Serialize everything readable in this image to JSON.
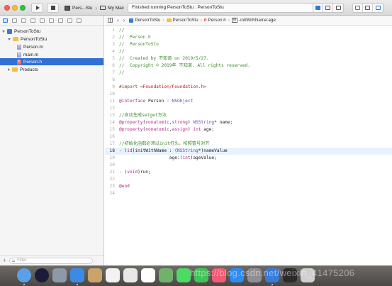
{
  "toolbar": {
    "scheme_target": "Pers...Stu",
    "scheme_device": "My Mac",
    "activity_status": "Finished running PersonToStu : PersonToStu"
  },
  "navigator": {
    "items": [
      {
        "label": "PersonToStu",
        "kind": "project"
      },
      {
        "label": "PersonToStu",
        "kind": "folder"
      },
      {
        "label": "Person.m",
        "kind": "m"
      },
      {
        "label": "main.m",
        "kind": "m"
      },
      {
        "label": "Person.h",
        "kind": "h",
        "selected": true
      },
      {
        "label": "Products",
        "kind": "folder"
      }
    ],
    "filter_placeholder": "Filter"
  },
  "jumpbar": {
    "crumbs": [
      "PersonToStu",
      "PersonToStu",
      "Person.h",
      "-initWithName:age:"
    ]
  },
  "editor": {
    "current_line": 18,
    "lines": [
      {
        "n": "1",
        "t": "//"
      },
      {
        "n": "2",
        "t": "//  Person.h"
      },
      {
        "n": "3",
        "t": "//  PersonToStu"
      },
      {
        "n": "4",
        "t": "//"
      },
      {
        "n": "5",
        "t": "//  Created by 不知道 on 2019/5/27."
      },
      {
        "n": "6",
        "t": "//  Copyright © 2019年 不知道. All rights reserved."
      },
      {
        "n": "7",
        "t": "//"
      },
      {
        "n": "8",
        "t": ""
      },
      {
        "n": "9",
        "t": "#import <Foundation/Foundation.h>"
      },
      {
        "n": "10",
        "t": ""
      },
      {
        "n": "11",
        "t": "@interface Person : NSObject"
      },
      {
        "n": "12",
        "t": ""
      },
      {
        "n": "13",
        "t": "//自动生成setget方法"
      },
      {
        "n": "14",
        "t": "@property(nonatomic,strong) NSString* name;"
      },
      {
        "n": "15",
        "t": "@property(nonatomic,assign) int age;"
      },
      {
        "n": "16",
        "t": ""
      },
      {
        "n": "17",
        "t": "//初始化函数必须以init打头，按照冒号对齐"
      },
      {
        "n": "18",
        "t": "- (id)initWithName : (NSString*)nameValue"
      },
      {
        "n": "19",
        "t": "                   age:(int)ageValue;"
      },
      {
        "n": "20",
        "t": ""
      },
      {
        "n": "21",
        "t": "- (void)run;"
      },
      {
        "n": "22",
        "t": ""
      },
      {
        "n": "23",
        "t": "@end"
      },
      {
        "n": "24",
        "t": ""
      }
    ]
  },
  "dock": {
    "apps": [
      "finder-icon",
      "siri-icon",
      "launchpad-icon",
      "safari-icon",
      "notes-icon",
      "calendar-icon",
      "photos-icon",
      "reminders-icon",
      "maps-icon",
      "messages-icon",
      "facetime-icon",
      "music-icon",
      "appstore-icon",
      "preferences-icon",
      "xcode-icon",
      "terminal-icon",
      "trash-icon"
    ],
    "watermark": "https://blog.csdn.net/weixin_41475206"
  }
}
